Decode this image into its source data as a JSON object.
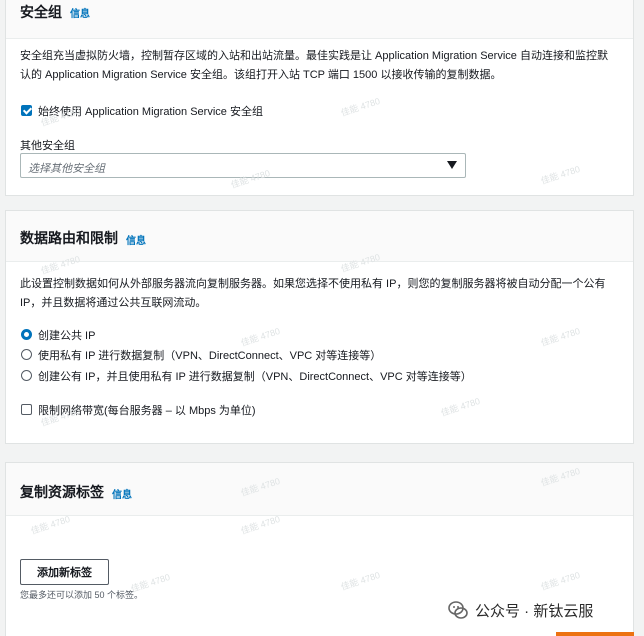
{
  "security_group": {
    "title": "安全组",
    "info": "信息",
    "description": "安全组充当虚拟防火墙，控制暂存区域的入站和出站流量。最佳实践是让 Application Migration Service 自动连接和监控默认的 Application Migration Service 安全组。该组打开入站 TCP 端口 1500 以接收传输的复制数据。",
    "always_use_label": "始终使用 Application Migration Service 安全组",
    "always_use_checked": true,
    "other_groups_label": "其他安全组",
    "other_groups_placeholder": "选择其他安全组"
  },
  "data_routing": {
    "title": "数据路由和限制",
    "info": "信息",
    "description": "此设置控制数据如何从外部服务器流向复制服务器。如果您选择不使用私有 IP，则您的复制服务器将被自动分配一个公有 IP，并且数据将通过公共互联网流动。",
    "options": [
      {
        "label": "创建公共 IP",
        "selected": true
      },
      {
        "label": "使用私有 IP 进行数据复制（VPN、DirectConnect、VPC 对等连接等）",
        "selected": false
      },
      {
        "label": "创建公有 IP，并且使用私有 IP 进行数据复制（VPN、DirectConnect、VPC 对等连接等）",
        "selected": false
      }
    ],
    "throttle_label": "限制网络带宽(每台服务器 – 以 Mbps 为单位)",
    "throttle_checked": false
  },
  "tags": {
    "title": "复制资源标签",
    "info": "信息",
    "add_button": "添加新标签",
    "hint": "您最多还可以添加 50 个标签。"
  },
  "watermark_text": "佳能 4780",
  "footer": {
    "wechat_account": "公众号 · 新钛云服"
  },
  "colors": {
    "link": "#0073bb",
    "accent": "#ec7211",
    "page_bg": "#f2f3f3"
  }
}
